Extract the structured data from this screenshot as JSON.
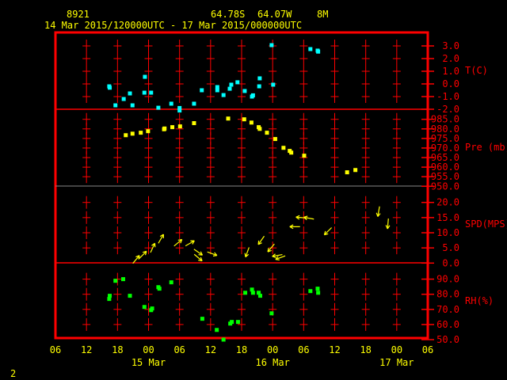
{
  "header": {
    "station": "8921",
    "lat": "64.78S",
    "lon": "64.07W",
    "elevation": "8M",
    "period": "14 Mar 2015/120000UTC - 17 Mar 2015/000000UTC"
  },
  "footer": {
    "page": "2"
  },
  "colors": {
    "frame": "#ff0000",
    "temperature": "#00ffff",
    "pressure": "#ffff00",
    "wind": "#ffff00",
    "rh": "#00ff00",
    "text": "#ffff00"
  },
  "chart_data": {
    "type": "scatter",
    "title": "8921  64.78S 64.07W 8M  14 Mar 2015/120000UTC - 17 Mar 2015/000000UTC",
    "x_units": "hours since 14 Mar 06 UTC",
    "xlim": [
      0,
      72
    ],
    "x_ticks": [
      "06",
      "12",
      "18",
      "00",
      "06",
      "12",
      "18",
      "00",
      "06",
      "12",
      "18",
      "00",
      "06"
    ],
    "date_labels": [
      {
        "label": "15 Mar",
        "hour": 18
      },
      {
        "label": "16 Mar",
        "hour": 42
      },
      {
        "label": "17 Mar",
        "hour": 66
      }
    ],
    "panels": [
      {
        "name": "temperature",
        "label": "T(C)",
        "ylim": [
          -2,
          4
        ],
        "ticks": [
          "3.0",
          "2.0",
          "1.0",
          "0.0",
          "-1.0",
          "-2.0"
        ],
        "tick_values": [
          3,
          2,
          1,
          0,
          -1,
          -2
        ],
        "points": [
          [
            10.4,
            -0.19
          ],
          [
            10.5,
            -0.3
          ],
          [
            11.6,
            -1.69
          ],
          [
            13.2,
            -1.19
          ],
          [
            14.4,
            -0.75
          ],
          [
            14.9,
            -1.69
          ],
          [
            17.2,
            -0.69
          ],
          [
            17.3,
            0.56
          ],
          [
            18.5,
            -0.69
          ],
          [
            19.9,
            -1.88
          ],
          [
            22.4,
            -1.56
          ],
          [
            24.0,
            -1.9
          ],
          [
            24.0,
            -2.1
          ],
          [
            26.8,
            -1.56
          ],
          [
            28.3,
            -0.5
          ],
          [
            31.3,
            -0.25
          ],
          [
            31.3,
            -0.5
          ],
          [
            32.5,
            -0.88
          ],
          [
            33.7,
            -0.38
          ],
          [
            34.0,
            -0.06
          ],
          [
            35.2,
            0.13
          ],
          [
            36.6,
            -0.56
          ],
          [
            38.0,
            -1.0
          ],
          [
            38.2,
            -0.9
          ],
          [
            39.4,
            -0.19
          ],
          [
            39.5,
            0.44
          ],
          [
            41.8,
            3.06
          ],
          [
            42.1,
            -0.06
          ],
          [
            49.3,
            2.75
          ],
          [
            50.7,
            2.63
          ],
          [
            50.8,
            2.55
          ]
        ]
      },
      {
        "name": "pressure",
        "label": "Pre (mb)",
        "ylim": [
          950,
          990
        ],
        "ticks": [
          "985.0",
          "980.0",
          "975.0",
          "970.0",
          "965.0",
          "960.0",
          "955.0",
          "950.0"
        ],
        "tick_values": [
          985,
          980,
          975,
          970,
          965,
          960,
          955,
          950
        ],
        "points": [
          [
            13.6,
            976.7
          ],
          [
            14.9,
            977.5
          ],
          [
            16.5,
            978.0
          ],
          [
            17.9,
            978.8
          ],
          [
            21.0,
            979.8
          ],
          [
            21.1,
            980.2
          ],
          [
            22.6,
            980.9
          ],
          [
            24.1,
            981.3
          ],
          [
            26.8,
            983.0
          ],
          [
            33.4,
            985.4
          ],
          [
            36.5,
            985.0
          ],
          [
            37.9,
            983.3
          ],
          [
            39.3,
            980.9
          ],
          [
            39.5,
            980.0
          ],
          [
            40.9,
            978.0
          ],
          [
            42.5,
            974.7
          ],
          [
            44.1,
            970.1
          ],
          [
            45.3,
            968.5
          ],
          [
            45.6,
            967.6
          ],
          [
            48.1,
            966.0
          ],
          [
            56.4,
            957.3
          ],
          [
            58.0,
            958.5
          ]
        ]
      },
      {
        "name": "wind",
        "label": "SPD(MPS)",
        "ylim": [
          0,
          20
        ],
        "ticks": [
          "20.0",
          "15.0",
          "10.0",
          "5.0",
          "0.0"
        ],
        "tick_values": [
          20,
          15,
          10,
          5,
          0
        ],
        "points": [
          [
            15.6,
            1.2,
            40
          ],
          [
            16.9,
            2.7,
            45
          ],
          [
            18.8,
            5.0,
            25
          ],
          [
            20.4,
            8.0,
            30
          ],
          [
            23.7,
            6.7,
            50
          ],
          [
            26.0,
            6.5,
            60
          ],
          [
            27.6,
            3.6,
            125
          ],
          [
            27.6,
            1.8,
            130
          ],
          [
            30.3,
            3.1,
            110
          ],
          [
            37.1,
            3.6,
            200
          ],
          [
            39.8,
            7.5,
            215
          ],
          [
            41.7,
            5.0,
            220
          ],
          [
            42.9,
            2.5,
            260
          ],
          [
            43.5,
            1.8,
            250
          ],
          [
            46.3,
            12.0,
            270
          ],
          [
            47.5,
            15.0,
            275
          ],
          [
            49.0,
            14.8,
            280
          ],
          [
            52.7,
            10.5,
            225
          ],
          [
            62.5,
            17.0,
            190
          ],
          [
            64.3,
            13.0,
            185
          ]
        ]
      },
      {
        "name": "rh",
        "label": "RH(%)",
        "ylim": [
          50,
          100
        ],
        "ticks": [
          "90.0",
          "80.0",
          "70.0",
          "60.0",
          "50.0"
        ],
        "tick_values": [
          90,
          80,
          70,
          60,
          50
        ],
        "points": [
          [
            10.4,
            76.9
          ],
          [
            10.5,
            79.0
          ],
          [
            11.6,
            88.9
          ],
          [
            13.1,
            90.0
          ],
          [
            14.4,
            79.0
          ],
          [
            17.2,
            71.6
          ],
          [
            18.5,
            69.5
          ],
          [
            18.7,
            70.6
          ],
          [
            19.9,
            84.7
          ],
          [
            20.1,
            83.7
          ],
          [
            22.4,
            87.9
          ],
          [
            28.4,
            63.8
          ],
          [
            31.2,
            56.4
          ],
          [
            32.5,
            50.0
          ],
          [
            33.8,
            60.6
          ],
          [
            34.1,
            61.7
          ],
          [
            35.3,
            61.7
          ],
          [
            36.7,
            81.0
          ],
          [
            38.0,
            83.1
          ],
          [
            38.2,
            81.0
          ],
          [
            39.3,
            81.0
          ],
          [
            39.6,
            79.0
          ],
          [
            41.8,
            67.4
          ],
          [
            49.3,
            82.1
          ],
          [
            50.7,
            83.7
          ],
          [
            50.8,
            81.0
          ]
        ]
      }
    ]
  }
}
